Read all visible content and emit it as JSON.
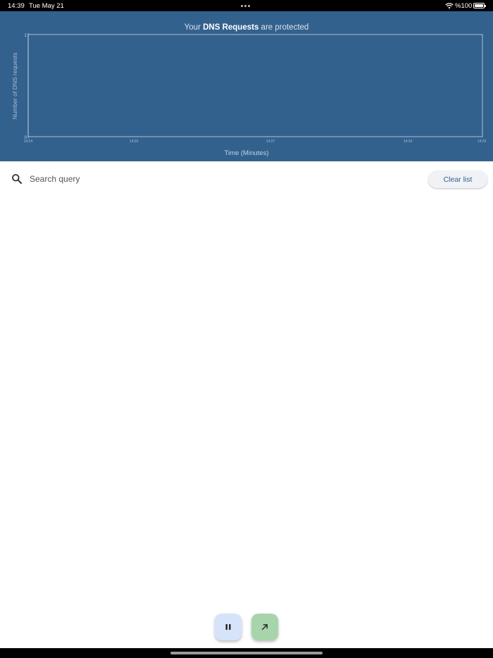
{
  "status_bar": {
    "time": "14:39",
    "date": "Tue May 21",
    "battery": "%100"
  },
  "chart": {
    "title_prefix": "Your ",
    "title_bold": "DNS Requests",
    "title_suffix": " are protected"
  },
  "chart_data": {
    "type": "line",
    "ylabel": "Number of DNS requests",
    "xlabel": "Time (Minutes)",
    "yticks": [
      "0",
      "1"
    ],
    "xticks": [
      "14:24",
      "14:26",
      "14:27",
      "14:29",
      "14:29"
    ],
    "ylim": [
      0,
      1
    ],
    "series": [],
    "colors": {
      "background": "#33618e",
      "frame": "#c9d6e6",
      "text": "#c3d3e5"
    }
  },
  "search": {
    "placeholder": "Search query",
    "icon": "search-icon"
  },
  "actions": {
    "clear_label": "Clear list",
    "pause_icon": "pause-icon",
    "open_icon": "arrow-up-right-icon"
  }
}
